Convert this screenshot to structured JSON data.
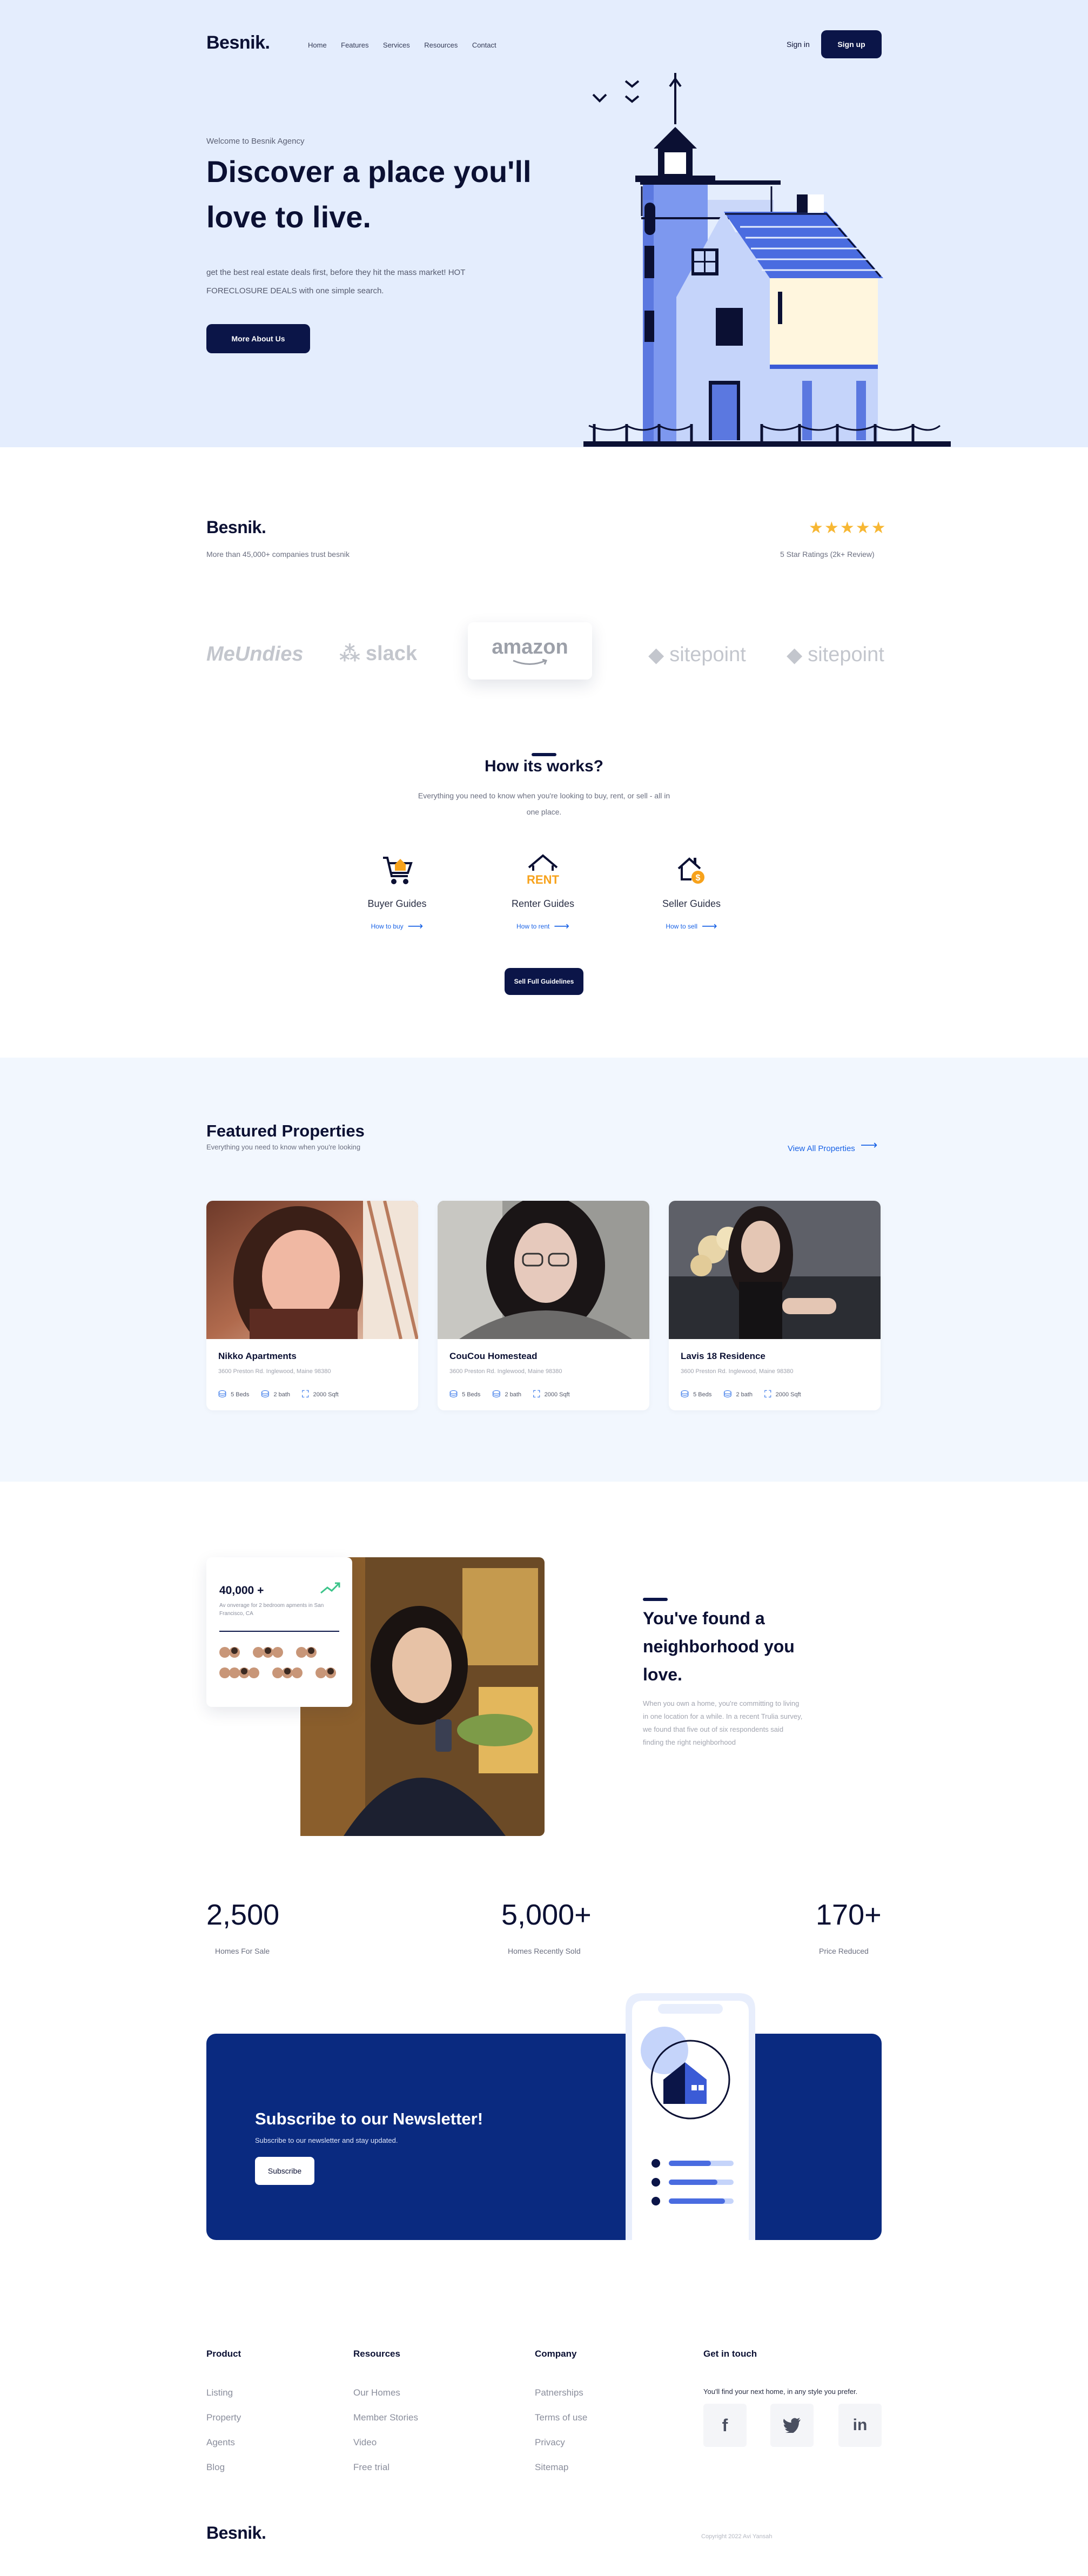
{
  "nav": {
    "logo": "Besnik.",
    "links": [
      "Home",
      "Features",
      "Services",
      "Resources",
      "Contact"
    ],
    "signin": "Sign in",
    "signup": "Sign up"
  },
  "hero": {
    "eyebrow": "Welcome to Besnik Agency",
    "title_line1": "Discover a place you'll",
    "title_line2": "love to live.",
    "desc_line1": "get the best real estate deals first, before they hit the mass market! HOT",
    "desc_line2": "FORECLOSURE DEALS with one simple search.",
    "cta": "More About Us"
  },
  "trust": {
    "logo": "Besnik.",
    "text": "More than 45,000+ companies trust besnik",
    "rating_text": "5 Star Ratings (2k+ Review)",
    "stars": 5,
    "brands": [
      "MeUndies",
      "slack",
      "amazon",
      "sitepoint",
      "sitepoint"
    ]
  },
  "how": {
    "title": "How its works?",
    "desc_line1": "Everything you need to know when you're looking to buy, rent, or sell - all in",
    "desc_line2": "one place.",
    "guides": [
      {
        "label": "Buyer Guides",
        "link": "How to buy",
        "icon": "cart-house-icon"
      },
      {
        "label": "Renter Guides",
        "link": "How to rent",
        "icon": "rent-house-icon"
      },
      {
        "label": "Seller Guides",
        "link": "How to sell",
        "icon": "sell-house-icon"
      }
    ],
    "cta": "Sell Full Guidelines"
  },
  "featured": {
    "title": "Featured Properties",
    "subtitle": "Everything you need to know when you're looking",
    "view_all": "View All Properties",
    "cards": [
      {
        "title": "Nikko Apartments",
        "address": "3600 Preston Rd. Inglewood, Maine 98380",
        "beds": "5 Beds",
        "bath": "2 bath",
        "area": "2000 Sqft"
      },
      {
        "title": "CouCou Homestead",
        "address": "3600 Preston Rd. Inglewood, Maine 98380",
        "beds": "5 Beds",
        "bath": "2 bath",
        "area": "2000 Sqft"
      },
      {
        "title": "Lavis 18 Residence",
        "address": "3600 Preston Rd. Inglewood, Maine 98380",
        "beds": "5 Beds",
        "bath": "2 bath",
        "area": "2000 Sqft"
      }
    ]
  },
  "neighborhood": {
    "stat_value": "40,000 +",
    "stat_desc_line1": "Av onverage for 2 bedroom apments in San",
    "stat_desc_line2": "Francisco, CA",
    "title_line1": "You've found a",
    "title_line2": "neighborhood you",
    "title_line3": "love.",
    "desc_line1": "When you own a home, you're committing to living",
    "desc_line2": "in one location for a while. In a recent Trulia survey,",
    "desc_line3": "we found that five out of six respondents said",
    "desc_line4": "finding the right neighborhood"
  },
  "stats": [
    {
      "value": "2,500",
      "label": "Homes For Sale"
    },
    {
      "value": "5,000+",
      "label": "Homes Recently Sold"
    },
    {
      "value": "170+",
      "label": "Price Reduced"
    }
  ],
  "newsletter": {
    "title": "Subscribe to our Newsletter!",
    "desc": "Subscribe to our newsletter and stay updated.",
    "button": "Subscribe"
  },
  "footer": {
    "columns": [
      {
        "heading": "Product",
        "links": [
          "Listing",
          "Property",
          "Agents",
          "Blog"
        ]
      },
      {
        "heading": "Resources",
        "links": [
          "Our Homes",
          "Member Stories",
          "Video",
          "Free trial"
        ]
      },
      {
        "heading": "Company",
        "links": [
          "Patnerships",
          "Terms of use",
          "Privacy",
          "Sitemap"
        ]
      }
    ],
    "contact_heading": "Get in touch",
    "contact_text": "You'll find your next home, in any style you prefer.",
    "socials": [
      "facebook-icon",
      "twitter-icon",
      "linkedin-icon"
    ],
    "logo": "Besnik.",
    "copyright": "Copyright 2022 Avi Yansah"
  },
  "colors": {
    "navy": "#0b1548",
    "hero_bg": "#e4edfd",
    "accent_blue": "#1a63e6",
    "newsletter_bg": "#0a2a80",
    "star": "#f7b733"
  }
}
